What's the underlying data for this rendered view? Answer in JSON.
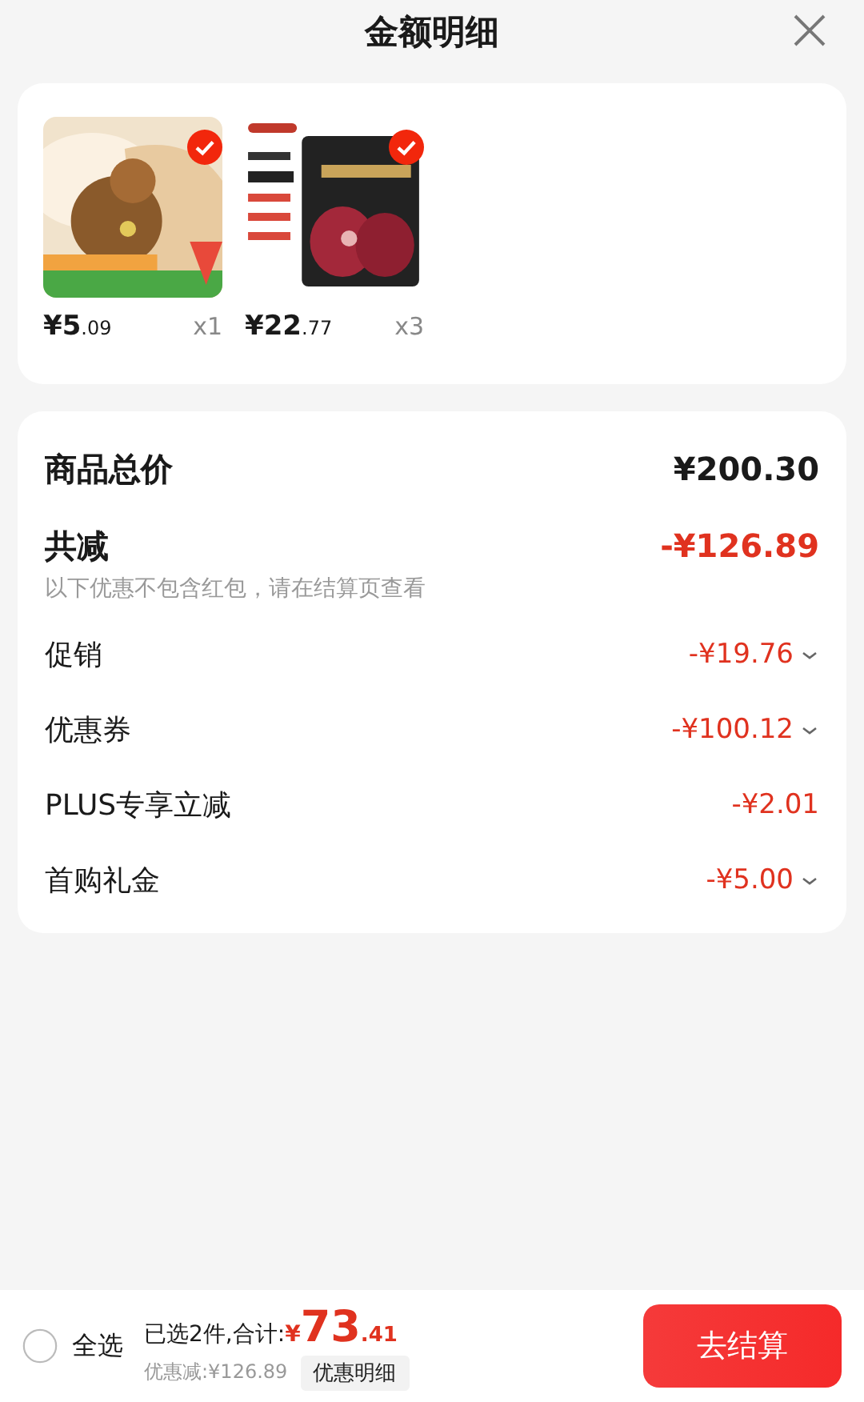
{
  "header": {
    "title": "金额明细"
  },
  "products": [
    {
      "price_main": "¥5",
      "price_decimal": ".09",
      "quantity": "x1",
      "checked": true
    },
    {
      "price_main": "¥22",
      "price_decimal": ".77",
      "quantity": "x3",
      "checked": true
    }
  ],
  "summary": {
    "total_label": "商品总价",
    "total_value": "¥200.30",
    "reduction_label": "共减",
    "reduction_value": "-¥126.89",
    "note": "以下优惠不包含红包，请在结算页查看",
    "items": [
      {
        "label": "促销",
        "value": "-¥19.76",
        "expandable": true
      },
      {
        "label": "优惠券",
        "value": "-¥100.12",
        "expandable": true
      },
      {
        "label": "PLUS专享立减",
        "value": "-¥2.01",
        "expandable": false
      },
      {
        "label": "首购礼金",
        "value": "-¥5.00",
        "expandable": true
      }
    ]
  },
  "footer": {
    "select_all": {
      "label": "全选",
      "checked": false
    },
    "selected_text": "已选2件,合计:",
    "currency": "¥",
    "total_main": "73",
    "total_decimal": ".41",
    "discount_text": "优惠减:¥126.89",
    "detail_button": "优惠明细",
    "checkout_button": "去结算"
  }
}
